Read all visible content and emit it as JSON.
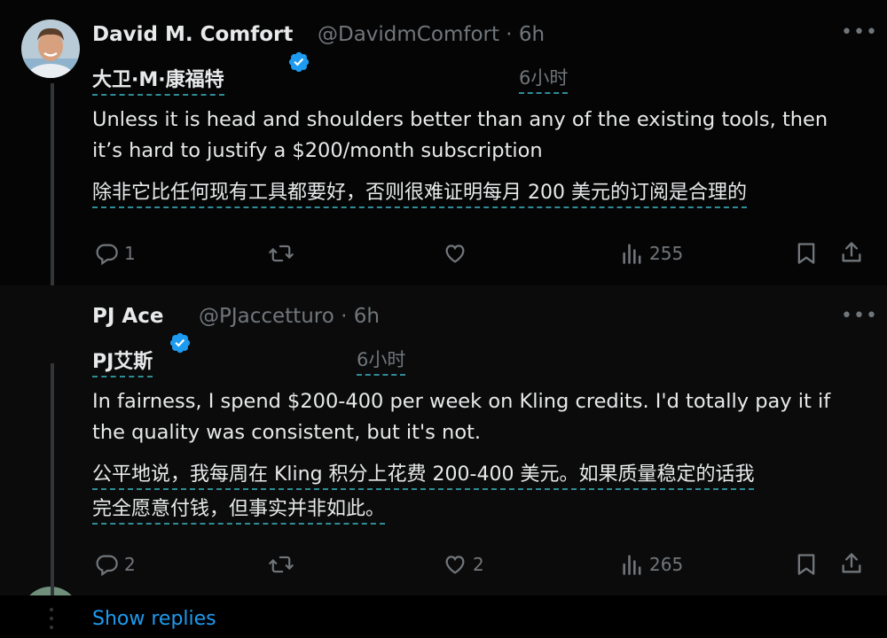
{
  "colors": {
    "accent": "#1d9bf0",
    "muted": "#71767b",
    "text": "#e7e9ea",
    "translation_underline": "#2f8c96"
  },
  "tweets": [
    {
      "name": "David M. Comfort",
      "handle": "@DavidmComfort · 6h",
      "translated_name": "大卫·M·康福特",
      "translated_time": "6小时",
      "verified": true,
      "body_en": [
        "Unless it is head and shoulders better than any of the existing tools, then",
        "it’s hard to justify a $200/month subscription"
      ],
      "body_zh": [
        "除非它比任何现有工具都要好，否则很难证明每月 200 美元的订阅是合理的"
      ],
      "replies": "1",
      "retweets": "",
      "likes": "",
      "views": "255",
      "icons": [
        "reply-icon",
        "retweet-icon",
        "like-icon",
        "views-icon",
        "bookmark-icon",
        "share-icon"
      ]
    },
    {
      "name": "PJ Ace",
      "handle": "@PJaccetturo · 6h",
      "translated_name": "PJ艾斯",
      "translated_time": "6小时",
      "verified": true,
      "body_en": [
        "In fairness, I spend $200-400 per week on Kling credits. I'd totally pay it if",
        "the quality was consistent, but it's not."
      ],
      "body_zh": [
        "公平地说，我每周在 Kling 积分上花费 200-400 美元。如果质量稳定的话我",
        "完全愿意付钱，但事实并非如此。"
      ],
      "replies": "2",
      "retweets": "",
      "likes": "2",
      "views": "265",
      "icons": [
        "reply-icon",
        "retweet-icon",
        "like-icon",
        "views-icon",
        "bookmark-icon",
        "share-icon"
      ]
    }
  ],
  "show_replies": "Show replies"
}
